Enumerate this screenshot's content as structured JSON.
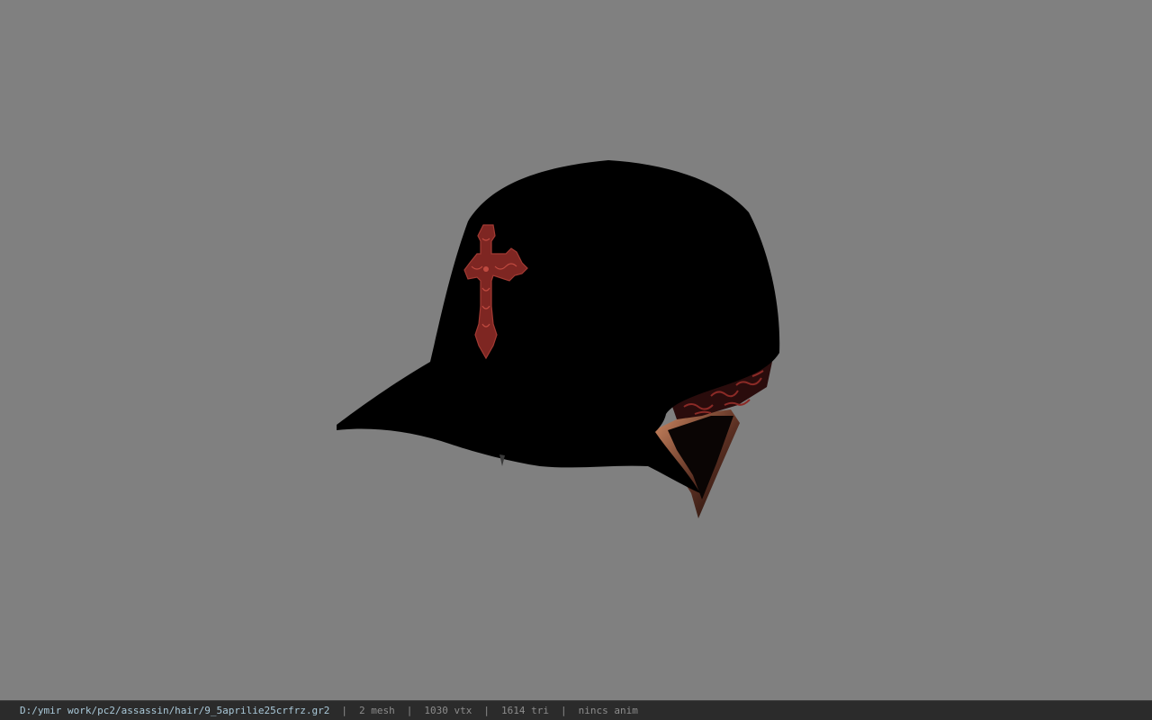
{
  "viewer": {
    "background_color": "#808080",
    "model": {
      "object": "baseball cap",
      "colors": {
        "cap": "#000000",
        "cross_print": "#8b2a26",
        "bandana": "#7a1f1f",
        "hair": "#c07a55"
      }
    }
  },
  "status_bar": {
    "file_path": "D:/ymir work/pc2/assassin/hair/9_5aprilie25crfrz.gr2",
    "separator": "|",
    "mesh_count": "2 mesh",
    "vertex_count": "1030 vtx",
    "triangle_count": "1614 tri",
    "animation": "nincs anim"
  }
}
